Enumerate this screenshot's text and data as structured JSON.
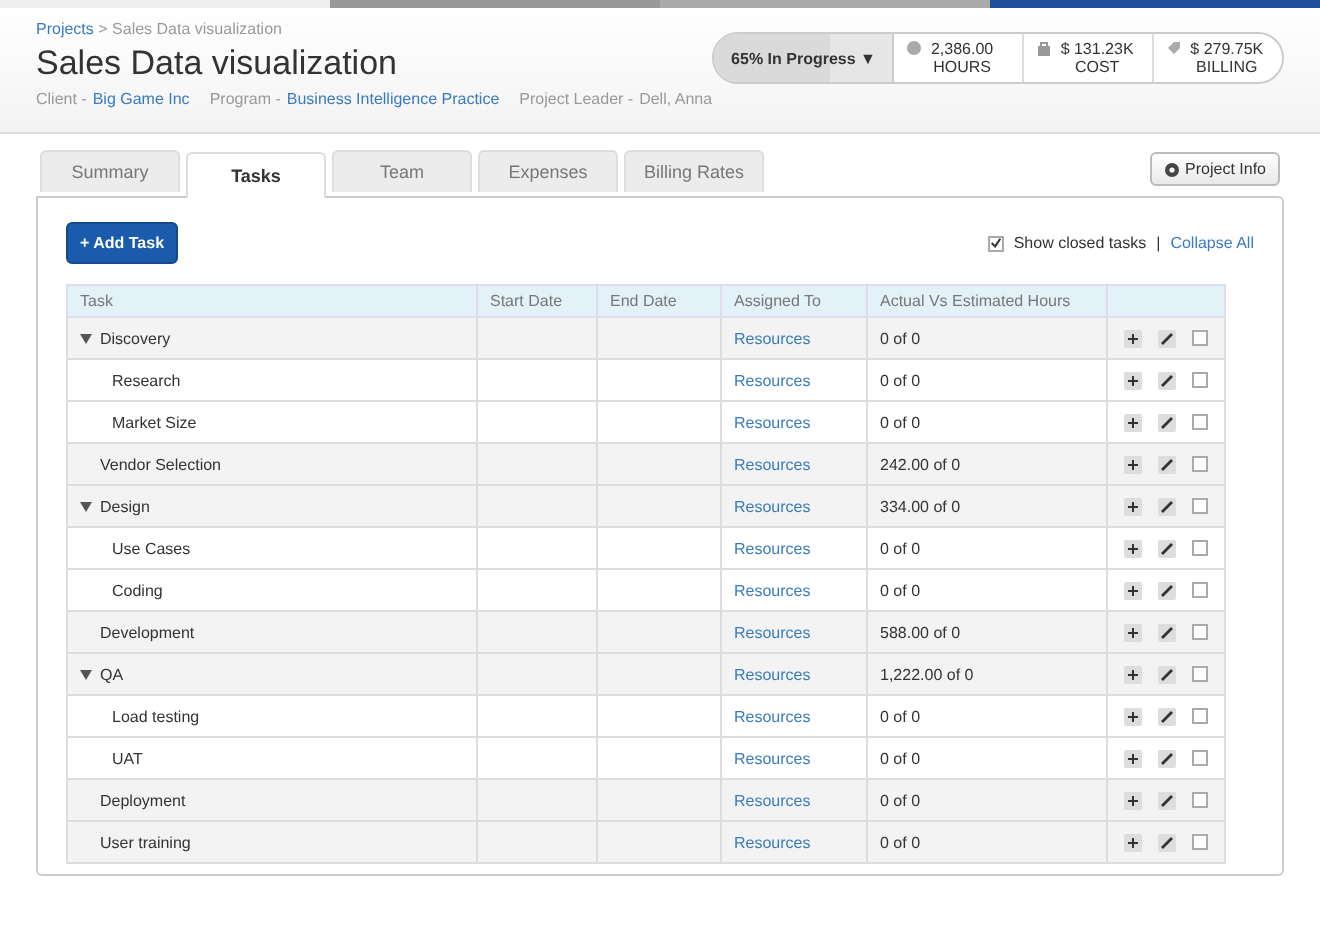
{
  "breadcrumb": {
    "link": "Projects",
    "separator": ">",
    "current": "Sales Data visualization"
  },
  "title": "Sales Data visualization",
  "meta": [
    {
      "label": "Client -",
      "value": "Big Game Inc",
      "kind": "link"
    },
    {
      "label": "Program -",
      "value": "Business Intelligence Practice",
      "kind": "link"
    },
    {
      "label": "Project Leader -",
      "value": "Dell, Anna",
      "kind": "text"
    }
  ],
  "status": {
    "label": "65% In Progress",
    "caret": "▼",
    "level": 0.65
  },
  "stats": [
    {
      "value": "2,386.00",
      "label": "HOURS",
      "kind": "clock"
    },
    {
      "value": "$ 131.23K",
      "label": "COST",
      "kind": "bag"
    },
    {
      "value": "$ 279.75K",
      "label": "BILLING",
      "kind": "tag"
    }
  ],
  "tabs": [
    {
      "label": "Summary",
      "selected": false
    },
    {
      "label": "Tasks",
      "selected": true
    },
    {
      "label": "Team",
      "selected": false
    },
    {
      "label": "Expenses",
      "selected": false
    },
    {
      "label": "Billing Rates",
      "selected": false
    }
  ],
  "project_info_button": "Project Info",
  "add_task_button": "+ Add Task",
  "show_closed": {
    "label": "Show closed tasks",
    "checked": true
  },
  "separator": "|",
  "collapse_all": "Collapse All",
  "table": {
    "columns": [
      "Task",
      "Start Date",
      "End Date",
      "Assigned To",
      "Actual Vs Estimated Hours"
    ],
    "rows": [
      {
        "task": "Discovery",
        "assigned": "Resources",
        "hours": "0 of 0",
        "expanded": true,
        "checked": false,
        "children": [
          {
            "task": "Research",
            "assigned": "Resources",
            "hours": "0 of 0",
            "checked": false
          },
          {
            "task": "Market Size",
            "assigned": "Resources",
            "hours": "0 of 0",
            "checked": false
          }
        ]
      },
      {
        "task": "Vendor Selection",
        "assigned": "Resources",
        "hours": "242.00 of 0",
        "checked": false
      },
      {
        "task": "Design",
        "assigned": "Resources",
        "hours": "334.00 of 0",
        "expanded": true,
        "checked": false,
        "children": [
          {
            "task": "Use Cases",
            "assigned": "Resources",
            "hours": "0 of 0",
            "checked": false
          },
          {
            "task": "Coding",
            "assigned": "Resources",
            "hours": "0 of 0",
            "checked": false
          }
        ]
      },
      {
        "task": "Development",
        "assigned": "Resources",
        "hours": "588.00 of 0",
        "checked": false
      },
      {
        "task": "QA",
        "assigned": "Resources",
        "hours": "1,222.00 of 0",
        "expanded": true,
        "checked": false,
        "children": [
          {
            "task": "Load testing",
            "assigned": "Resources",
            "hours": "0 of 0",
            "checked": false
          },
          {
            "task": "UAT",
            "assigned": "Resources",
            "hours": "0 of 0",
            "checked": false
          }
        ]
      },
      {
        "task": "Deployment",
        "assigned": "Resources",
        "hours": "0 of 0",
        "checked": false
      },
      {
        "task": "User training",
        "assigned": "Resources",
        "hours": "0 of 0",
        "checked": false
      }
    ]
  }
}
